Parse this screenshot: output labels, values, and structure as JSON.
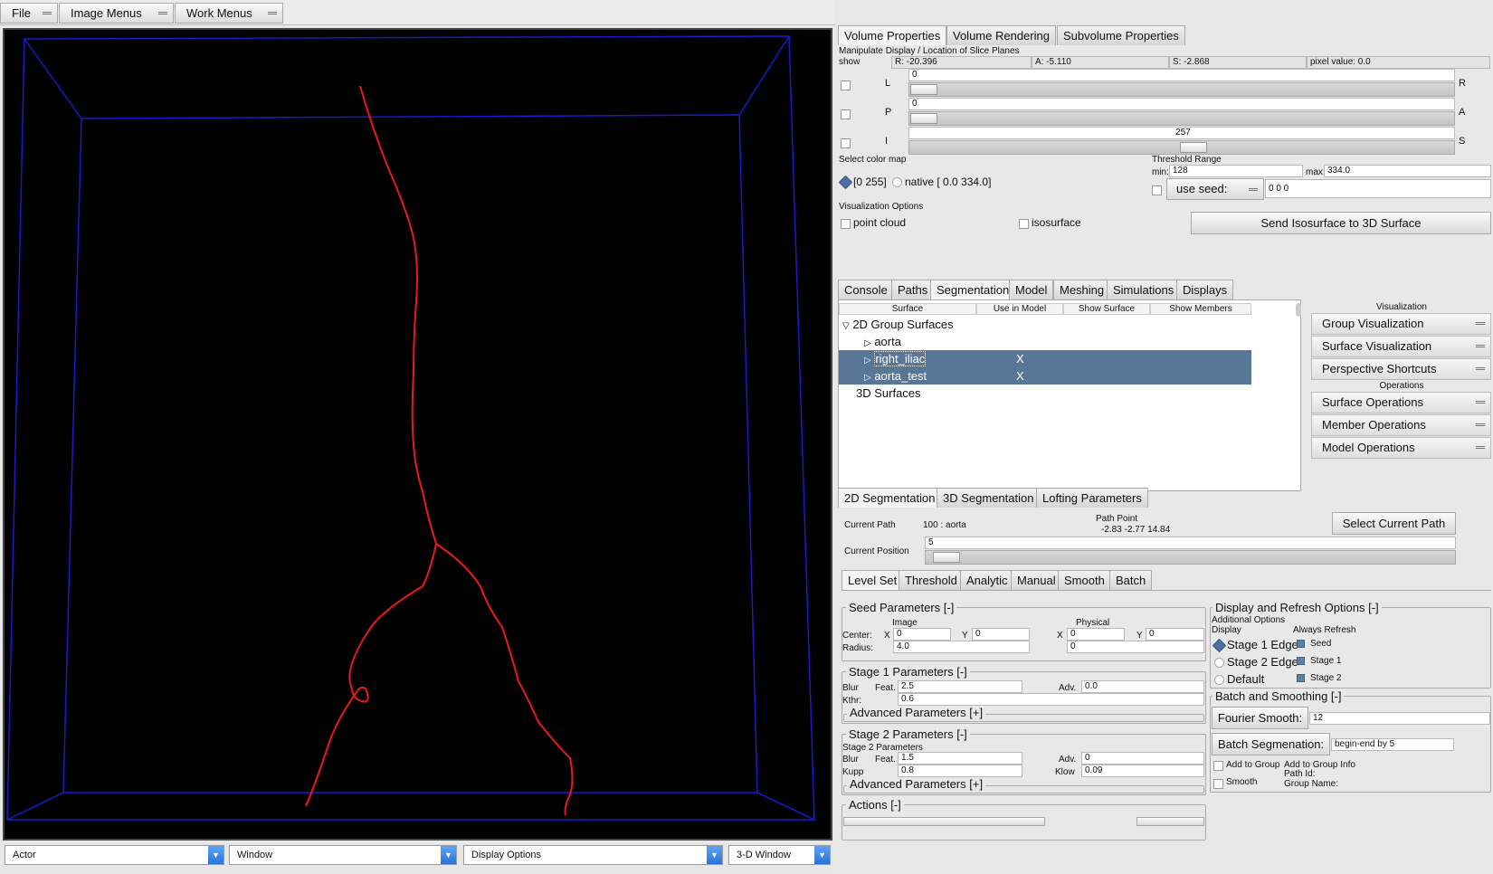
{
  "menubar": {
    "file": "File",
    "image_menus": "Image Menus",
    "work_menus": "Work Menus"
  },
  "view": {
    "colors": {
      "box": "#1a1acc",
      "path": "#e81a1a",
      "bg": "#000000"
    }
  },
  "bottombar": {
    "actor": "Actor",
    "window": "Window",
    "display_options": "Display Options",
    "view_mode": "3-D Window"
  },
  "top_tabs": [
    "Volume Properties",
    "Volume Rendering",
    "Subvolume Properties"
  ],
  "slice": {
    "heading": "Manipulate Display / Location of Slice Planes",
    "show": "show",
    "r": "R: -20.396",
    "a": "A: -5.110",
    "s": "S: -2.868",
    "pixel": "pixel value: 0.0",
    "planes": [
      {
        "left": "L",
        "right": "R",
        "value": "0"
      },
      {
        "left": "P",
        "right": "A",
        "value": "0"
      },
      {
        "left": "I",
        "right": "S",
        "value": "257"
      }
    ]
  },
  "colormap": {
    "label": "Select color map",
    "opt1": "[0 255]",
    "opt2": "native [ 0.0 334.0]"
  },
  "threshold": {
    "label": "Threshold Range",
    "min_label": "min:",
    "min": "128",
    "max_label": "max:",
    "max": "334.0",
    "use_seed": "use seed:",
    "seed": "0 0 0"
  },
  "vis": {
    "label": "Visualization Options",
    "point_cloud": "point cloud",
    "isosurface": "isosurface",
    "send": "Send Isosurface to 3D Surface"
  },
  "mid_tabs": [
    "Console",
    "Paths",
    "Segmentation",
    "Model",
    "Meshing",
    "Simulations",
    "Displays"
  ],
  "tree": {
    "columns": [
      "Surface",
      "Use in Model",
      "Show Surface",
      "Show Members"
    ],
    "group2d": "2D Group Surfaces",
    "items": [
      {
        "name": "aorta",
        "use": ""
      },
      {
        "name": "right_iliac",
        "use": "X"
      },
      {
        "name": "aorta_test",
        "use": "X"
      }
    ],
    "surfaces3d": "3D Surfaces"
  },
  "side": {
    "vis_label": "Visualization",
    "group_vis": "Group Visualization",
    "surface_vis": "Surface Visualization",
    "perspective": "Perspective Shortcuts",
    "ops_label": "Operations",
    "surface_ops": "Surface Operations",
    "member_ops": "Member Operations",
    "model_ops": "Model Operations"
  },
  "seg_tabs": [
    "2D Segmentation",
    "3D Segmentation",
    "Lofting Parameters"
  ],
  "path": {
    "current_path_label": "Current Path",
    "current_path": "100 : aorta",
    "path_point_label": "Path Point",
    "path_point": "-2.83  -2.77  14.84",
    "select": "Select Current Path",
    "position_label": "Current Position",
    "position": "5"
  },
  "method_tabs": [
    "Level Set",
    "Threshold",
    "Analytic",
    "Manual",
    "Smooth",
    "Batch"
  ],
  "seed": {
    "title": "Seed Parameters [-]",
    "image": "Image",
    "physical": "Physical",
    "center": "Center:",
    "x": "X",
    "y": "Y",
    "ix": "0",
    "iy": "0",
    "px": "0",
    "py": "0",
    "radius_label": "Radius:",
    "radius": "4.0",
    "radius2": "0"
  },
  "stage1": {
    "title": "Stage 1 Parameters [-]",
    "blur": "Blur",
    "feat": "Feat.",
    "feat_val": "2.5",
    "adv": "Adv.",
    "adv_val": "0.0",
    "kthr": "Kthr:",
    "kthr_val": "0.6",
    "advanced": "Advanced Parameters [+]"
  },
  "stage2": {
    "title": "Stage 2 Parameters [-]",
    "sub": "Stage 2 Parameters",
    "blur": "Blur",
    "feat": "Feat.",
    "feat_val": "1.5",
    "adv": "Adv.",
    "adv_val": "0",
    "kupp": "Kupp",
    "kupp_val": "0.8",
    "klow": "Klow",
    "klow_val": "0.09",
    "advanced": "Advanced Parameters [+]"
  },
  "actions": {
    "title": "Actions [-]"
  },
  "display": {
    "title": "Display and Refresh Options [-]",
    "additional": "Additional Options",
    "display": "Display",
    "always": "Always Refresh",
    "stage1": "Stage 1 Edge",
    "stage2": "Stage 2 Edge",
    "default": "Default",
    "seed": "Seed",
    "r1": "Stage 1",
    "r2": "Stage 2"
  },
  "batch": {
    "title": "Batch and Smoothing [-]",
    "fourier": "Fourier Smooth:",
    "fourier_val": "12",
    "batch_seg": "Batch Segmenation:",
    "batch_val": "begin-end by 5",
    "add_group": "Add to Group",
    "smooth": "Smooth",
    "add_info": "Add to Group Info",
    "path_id": "Path Id:",
    "group_name": "Group Name:"
  }
}
